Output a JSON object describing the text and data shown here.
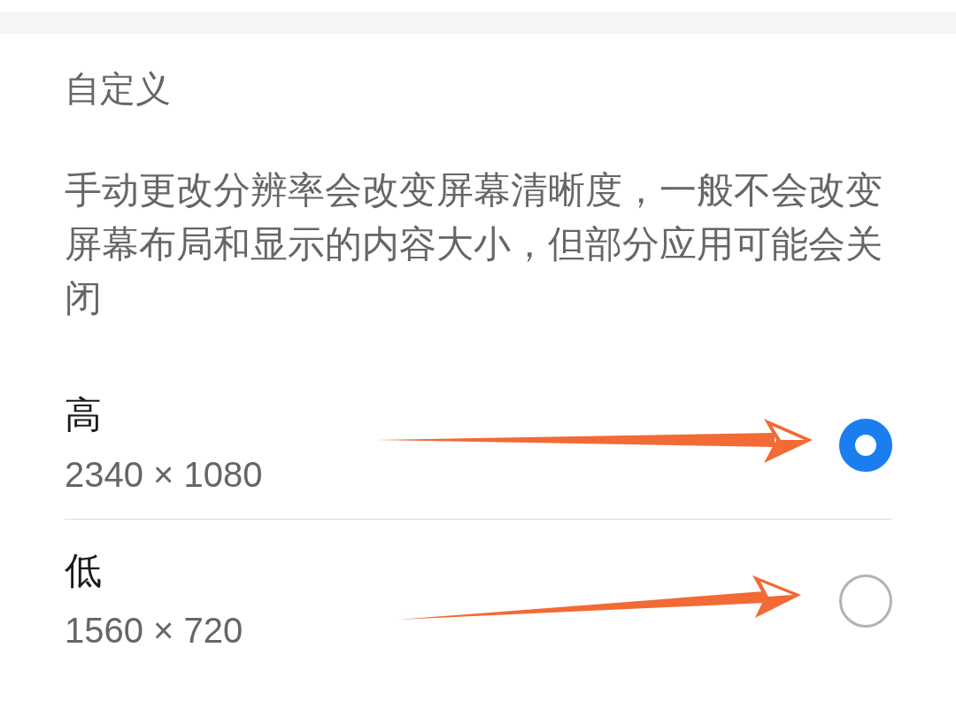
{
  "section_title": "自定义",
  "description": "手动更改分辨率会改变屏幕清晰度，一般不会改变屏幕布局和显示的内容大小，但部分应用可能会关闭",
  "options": [
    {
      "label": "高",
      "resolution": "2340 × 1080",
      "selected": true,
      "arrow": true
    },
    {
      "label": "低",
      "resolution": "1560 × 720",
      "selected": false,
      "arrow": true
    }
  ]
}
